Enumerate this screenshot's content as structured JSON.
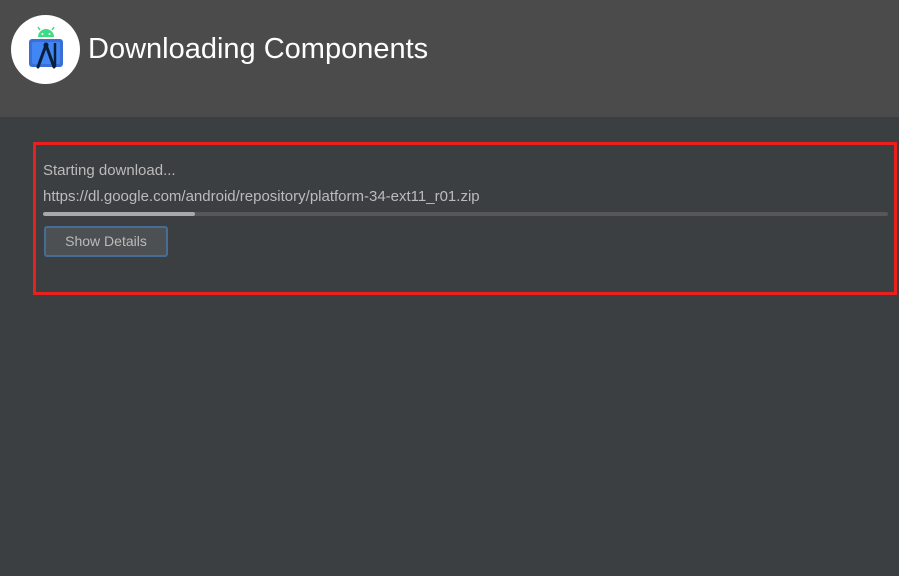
{
  "header": {
    "title": "Downloading Components",
    "logo_icon": "android-studio-icon"
  },
  "download": {
    "status": "Starting download...",
    "url": "https://dl.google.com/android/repository/platform-34-ext11_r01.zip",
    "progress_percent": 18,
    "show_details_label": "Show Details"
  },
  "colors": {
    "header_bg": "#4b4b4b",
    "content_bg": "#3c3f41",
    "highlight_border": "#e8211e",
    "button_border": "#466d94",
    "text": "#bbbbbb"
  }
}
